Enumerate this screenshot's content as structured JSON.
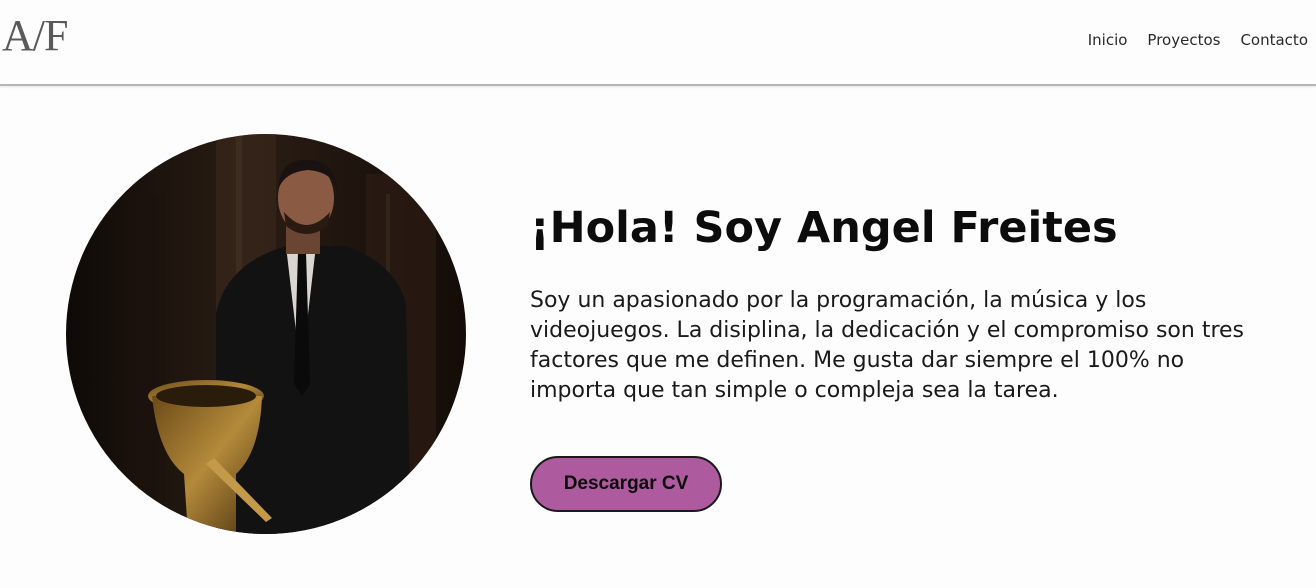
{
  "navbar": {
    "logo_text": "A/F",
    "links": [
      {
        "label": "Inicio"
      },
      {
        "label": "Proyectos"
      },
      {
        "label": "Contacto"
      }
    ]
  },
  "hero": {
    "title": "¡Hola! Soy Angel Freites",
    "description": "Soy un apasionado por la programación, la música y los videojuegos. La disiplina, la dedicación y el compromiso son tres factores que me definen. Me gusta dar siempre el 100% no importa que tan simple o compleja sea la tarea.",
    "button_label": "Descargar CV",
    "photo": "portrait-with-tuba-photo"
  },
  "colors": {
    "button_bg": "#ad5a9e",
    "page_bg": "#fdfdfd",
    "text": "#111111"
  }
}
